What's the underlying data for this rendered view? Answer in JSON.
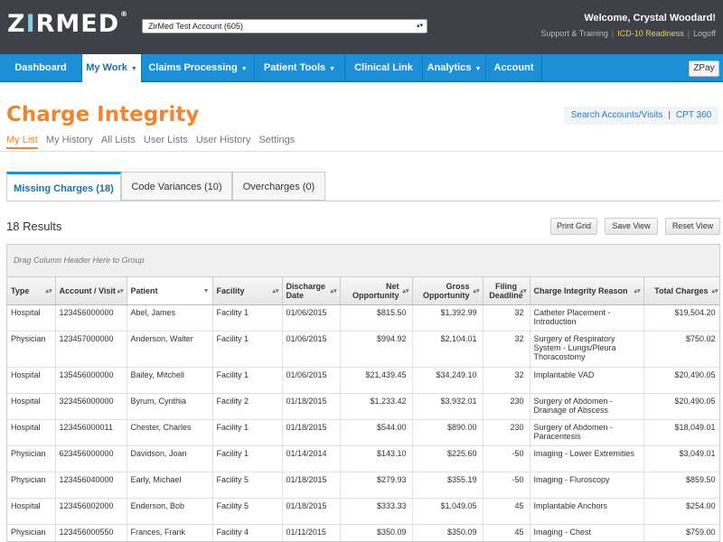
{
  "header": {
    "logo": {
      "part1": "Z",
      "part2": "I",
      "part3": "RMED",
      "reg": "®"
    },
    "account_select": "ZirMed Test Account (605)",
    "welcome": "Welcome, Crystal Woodard!",
    "links": [
      "Support & Training",
      "ICD-10 Readiness",
      "Logoff"
    ]
  },
  "nav": {
    "items": [
      {
        "label": "Dashboard"
      },
      {
        "label": "My Work"
      },
      {
        "label": "Claims Processing"
      },
      {
        "label": "Patient Tools"
      },
      {
        "label": "Clinical Link"
      },
      {
        "label": "Analytics"
      },
      {
        "label": "Account"
      }
    ],
    "zpay": "ZPay"
  },
  "page": {
    "title": "Charge Integrity",
    "quick_links": [
      "Search Accounts/Visits",
      "CPT 360"
    ],
    "subnav": [
      "My List",
      "My History",
      "All Lists",
      "User Lists",
      "User History",
      "Settings"
    ],
    "tabs": [
      "Missing Charges  (18)",
      "Code Variances  (10)",
      "Overcharges  (0)"
    ],
    "results": "18 Results",
    "buttons": [
      "Print Grid",
      "Save View",
      "Reset View"
    ]
  },
  "grid": {
    "group_hint": "Drag Column Header Here to Group",
    "columns": [
      "Type",
      "Account / Visit",
      "Patient",
      "Facility",
      "Discharge Date",
      "Net Opportunity",
      "Gross Opportunity",
      "Filing Deadline",
      "Charge Integrity Reason",
      "Total Charges"
    ],
    "rows": [
      [
        "Hospital",
        "123456000000",
        "Abel, James",
        "Facility 1",
        "01/06/2015",
        "$815.50",
        "$1,392.99",
        "32",
        "Catheter Placement - Introduction",
        "$19,504.20"
      ],
      [
        "Physician",
        "123457000000",
        "Anderson, Walter",
        "Facility 1",
        "01/06/2015",
        "$994.92",
        "$2,104.01",
        "32",
        "Surgery of Respiratory System - Lungs/Pleura Thoracostomy",
        "$750.02"
      ],
      [
        "Hospital",
        "135456000000",
        "Bailey, Mitchell",
        "Facility 1",
        "01/06/2015",
        "$21,439.45",
        "$34,249.10",
        "32",
        "Implantable VAD",
        "$20,490.05"
      ],
      [
        "Hospital",
        "323456000000",
        "Byrum, Cynthia",
        "Facility 2",
        "01/18/2015",
        "$1,233.42",
        "$3,932.01",
        "230",
        "Surgery of Abdomen - Drainage of Abscess",
        "$20,490.05"
      ],
      [
        "Hospital",
        "123456000011",
        "Chester, Charles",
        "Facility 1",
        "01/18/2015",
        "$544.00",
        "$890.00",
        "230",
        "Surgery of Abdomen - Paracentesis",
        "$18,049.01"
      ],
      [
        "Physician",
        "623456000000",
        "Davidson, Joan",
        "Facility 1",
        "01/14/2014",
        "$143.10",
        "$225.60",
        "-50",
        "Imaging - Lower Extremities",
        "$3,049.01"
      ],
      [
        "Physician",
        "123456040000",
        "Early, Michael",
        "Facility 5",
        "01/18/2015",
        "$279.93",
        "$355.19",
        "-50",
        "Imaging - Fluroscopy",
        "$859.50"
      ],
      [
        "Hospital",
        "123456002000",
        "Enderson, Bob",
        "Facility 5",
        "01/18/2015",
        "$333.33",
        "$1,049.05",
        "45",
        "Implantable Anchors",
        "$254.00"
      ],
      [
        "Physician",
        "123456000550",
        "Frances, Frank",
        "Facility 4",
        "01/11/2015",
        "$350.09",
        "$350.09",
        "45",
        "Imaging - Chest",
        "$759.00"
      ]
    ]
  }
}
